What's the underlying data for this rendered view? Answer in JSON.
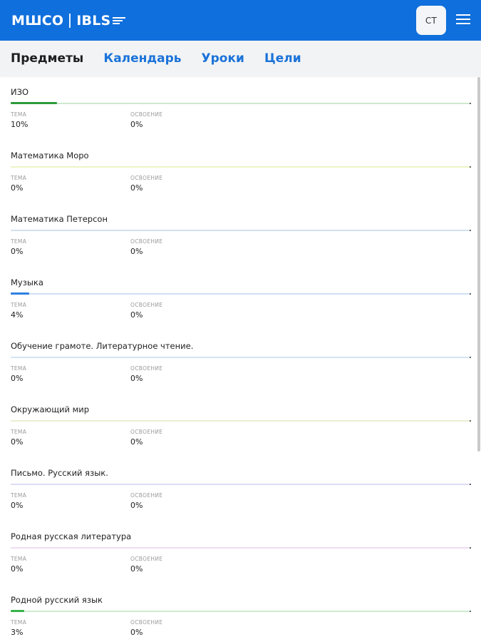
{
  "header": {
    "logo_left": "МШСО",
    "logo_right": "IBLS",
    "avatar_initials": "СТ",
    "brand_color": "#0f6fdc"
  },
  "tabs": [
    {
      "label": "Предметы",
      "active": true
    },
    {
      "label": "Календарь",
      "active": false
    },
    {
      "label": "Уроки",
      "active": false
    },
    {
      "label": "Цели",
      "active": false
    }
  ],
  "labels": {
    "topic": "ТЕМА",
    "mastery": "ОСВОЕНИЕ"
  },
  "subjects": [
    {
      "name": "ИЗО",
      "topic": "10%",
      "mastery": "0%",
      "progress": 0.1,
      "color": "#2e9b3a",
      "track_color": "#cfe8cf"
    },
    {
      "name": "Математика Моро",
      "topic": "0%",
      "mastery": "0%",
      "progress": 0,
      "color": "#d9e44a",
      "track_color": "#eef3c4"
    },
    {
      "name": "Математика Петерсон",
      "topic": "0%",
      "mastery": "0%",
      "progress": 0,
      "color": "#7aa6d8",
      "track_color": "#d3e1f1"
    },
    {
      "name": "Музыка",
      "topic": "4%",
      "mastery": "0%",
      "progress": 0.04,
      "color": "#2f7fe0",
      "track_color": "#cfe0f6"
    },
    {
      "name": "Обучение грамоте. Литературное чтение.",
      "topic": "0%",
      "mastery": "0%",
      "progress": 0,
      "color": "#7fb0e0",
      "track_color": "#d4e5f5"
    },
    {
      "name": "Окружающий мир",
      "topic": "0%",
      "mastery": "0%",
      "progress": 0,
      "color": "#c9d98a",
      "track_color": "#e8eed0"
    },
    {
      "name": "Письмо. Русский язык.",
      "topic": "0%",
      "mastery": "0%",
      "progress": 0,
      "color": "#a8a8e6",
      "track_color": "#dcdcf4"
    },
    {
      "name": "Родная русская литература",
      "topic": "0%",
      "mastery": "0%",
      "progress": 0,
      "color": "#d7a8e0",
      "track_color": "#eedcf2"
    },
    {
      "name": "Родной русский язык",
      "topic": "3%",
      "mastery": "0%",
      "progress": 0.03,
      "color": "#39b34a",
      "track_color": "#cfead2"
    }
  ]
}
